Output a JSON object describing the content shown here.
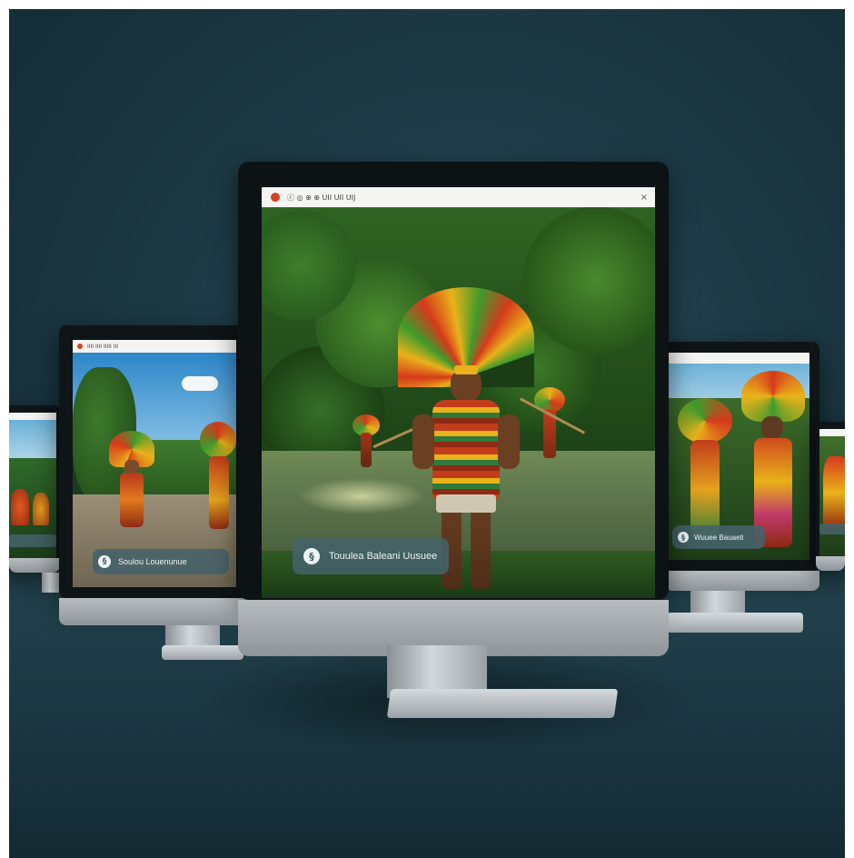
{
  "scene": {
    "background_color": "#1d3a45",
    "monitor_count": 5
  },
  "center_monitor": {
    "browser_bar": {
      "menu_text": "ⓒ ◎ ⊕ ⊕ UII  UII UIJ",
      "close_icon": "×",
      "record_dot_color": "#d5421f"
    },
    "caption": {
      "icon": "§",
      "text": "Touulea Baleani Uusuee"
    }
  },
  "left_monitor": {
    "browser_bar": {
      "menu_text": "IIII IIII  IIIII III"
    },
    "caption": {
      "icon": "§",
      "text": "Soulou Louenunue"
    }
  },
  "right_monitor": {
    "browser_bar": {
      "menu_text": ""
    },
    "caption": {
      "icon": "§",
      "text": "Wuuee Bauaeti"
    }
  },
  "far_left_monitor": {
    "caption": {
      "text": ""
    }
  },
  "far_right_monitor": {
    "caption": {
      "text": ""
    }
  },
  "colors": {
    "bezel": "#0f1417",
    "caption_bg": "#46626a",
    "foliage_dark": "#1f4a1f",
    "foliage_light": "#4f8a2e",
    "river": "#5f7a4a",
    "headdress_red": "#d63a1b",
    "headdress_yellow": "#e9b21a",
    "headdress_green": "#3f9a2c"
  }
}
